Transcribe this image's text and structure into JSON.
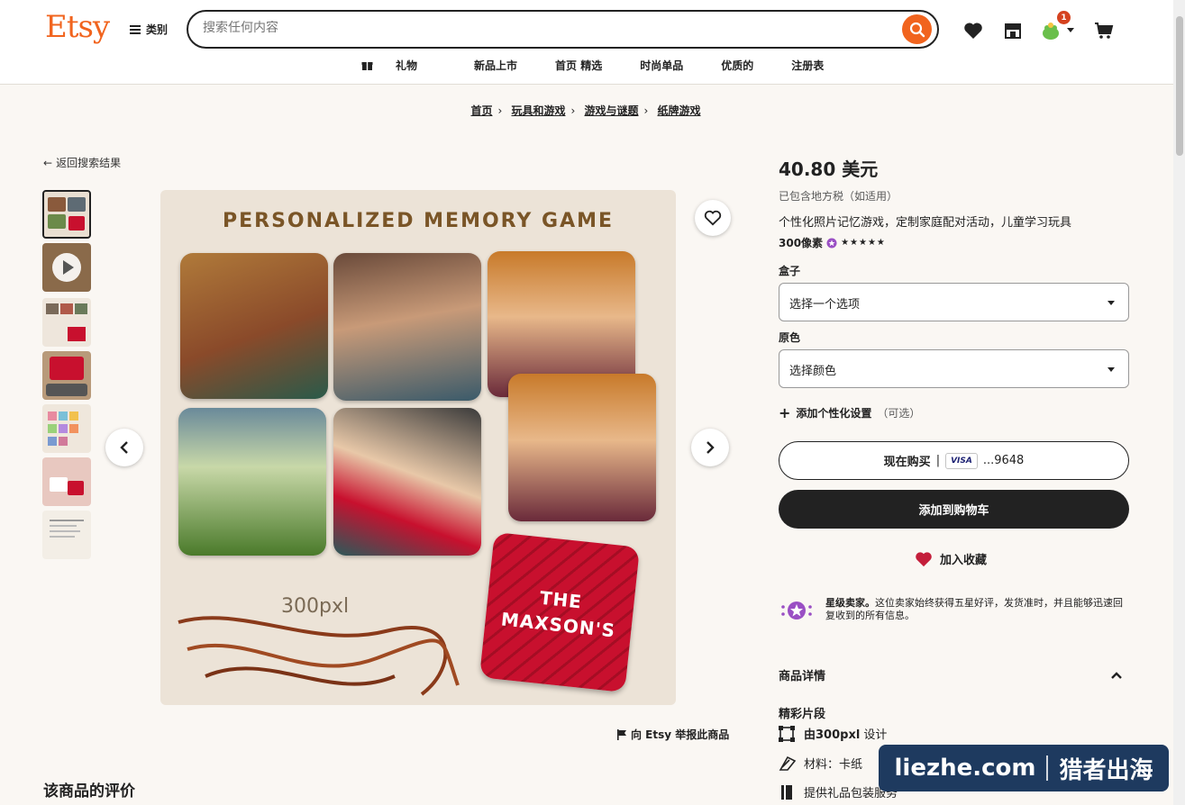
{
  "header": {
    "logo": "Etsy",
    "categories_label": "类别",
    "search_placeholder": "搜索任何内容",
    "cart_badge": "1",
    "nav": [
      "礼物",
      "新品上市",
      "首页 精选",
      "时尚单品",
      "优质的",
      "注册表"
    ]
  },
  "breadcrumb": [
    "首页",
    "玩具和游戏",
    "游戏与谜题",
    "纸牌游戏"
  ],
  "back_link": "返回搜索结果",
  "main_image": {
    "title": "PERSONALIZED MEMORY GAME",
    "brand": "300pxl",
    "card_line1": "THE",
    "card_line2": "MAXSON'S"
  },
  "report_link": "向 Etsy 举报此商品",
  "reviews_heading": "该商品的评价",
  "product": {
    "price": "40.80 美元",
    "tax_note": "已包含地方税（如适用）",
    "title": "个性化照片记忆游戏，定制家庭配对活动，儿童学习玩具",
    "seller": "300像素",
    "stars": "★★★★★",
    "box_label": "盒子",
    "box_value": "选择一个选项",
    "color_label": "原色",
    "color_value": "选择颜色",
    "personalize": "添加个性化设置",
    "optional": "（可选）",
    "buy_now": "现在购买",
    "buy_sep": "|",
    "card_brand": "VISA",
    "card_last4": "...9648",
    "add_to_cart": "添加到购物车",
    "add_to_favorites": "加入收藏",
    "star_seller_bold": "星级卖家。",
    "star_seller_text": "这位卖家始终获得五星好评，发货准时，并且能够迅速回复收到的所有信息。",
    "details_heading": "商品详情",
    "highlights_heading": "精彩片段",
    "highlights": [
      {
        "bold": "由300pxl",
        "text": " 设计"
      },
      {
        "bold": "",
        "text": "材料：卡纸"
      },
      {
        "bold": "",
        "text": "提供礼品包装服务"
      }
    ]
  },
  "watermark": {
    "left": "liezhe.com",
    "right": "猎者出海"
  },
  "colors": {
    "accent": "#f1641e",
    "dark": "#222222",
    "heart": "#c41e3a"
  }
}
